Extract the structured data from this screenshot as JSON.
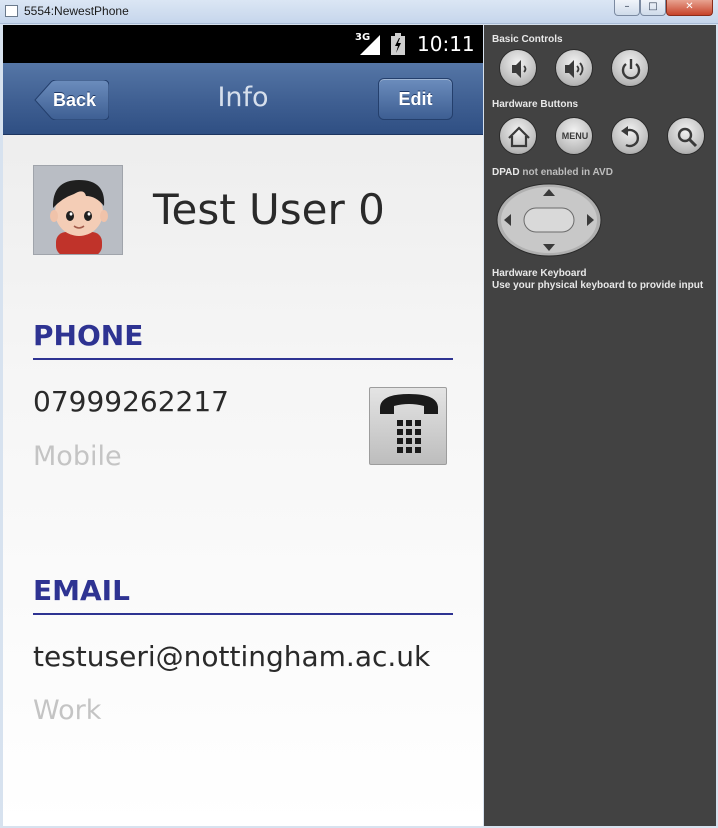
{
  "window": {
    "title": "5554:NewestPhone",
    "minimize_label": "–",
    "maximize_label": "□",
    "close_label": "✕"
  },
  "statusbar": {
    "network_label": "3G",
    "time": "10:11",
    "icons": [
      "signal-icon",
      "battery-charging-icon"
    ]
  },
  "navbar": {
    "title": "Info",
    "back_label": "Back",
    "edit_label": "Edit",
    "bar_color": "#3f5f92"
  },
  "contact": {
    "name": "Test User 0",
    "avatar_icon": "cartoon-user-avatar"
  },
  "phone_section": {
    "header": "PHONE",
    "number": "07999262217",
    "type": "Mobile",
    "action_icon": "telephone-keypad-icon"
  },
  "email_section": {
    "header": "EMAIL",
    "address": "testuseri@nottingham.ac.uk",
    "type": "Work"
  },
  "colors": {
    "section_header": "#2e3392",
    "secondary_text": "#c4c4c4",
    "emulator_panel": "#424242"
  },
  "emulator_panel": {
    "basic_controls_label": "Basic Controls",
    "hardware_buttons_label": "Hardware Buttons",
    "menu_button_label": "MENU",
    "dpad_label": "DPAD",
    "dpad_note": "not enabled in AVD",
    "keyboard_label": "Hardware Keyboard",
    "keyboard_note": "Use your physical keyboard to provide input",
    "basic_buttons": [
      "volume-down-icon",
      "volume-up-icon",
      "power-icon"
    ],
    "hardware_buttons": [
      "home-icon",
      "menu-button",
      "back-arrow-icon",
      "search-icon"
    ]
  }
}
